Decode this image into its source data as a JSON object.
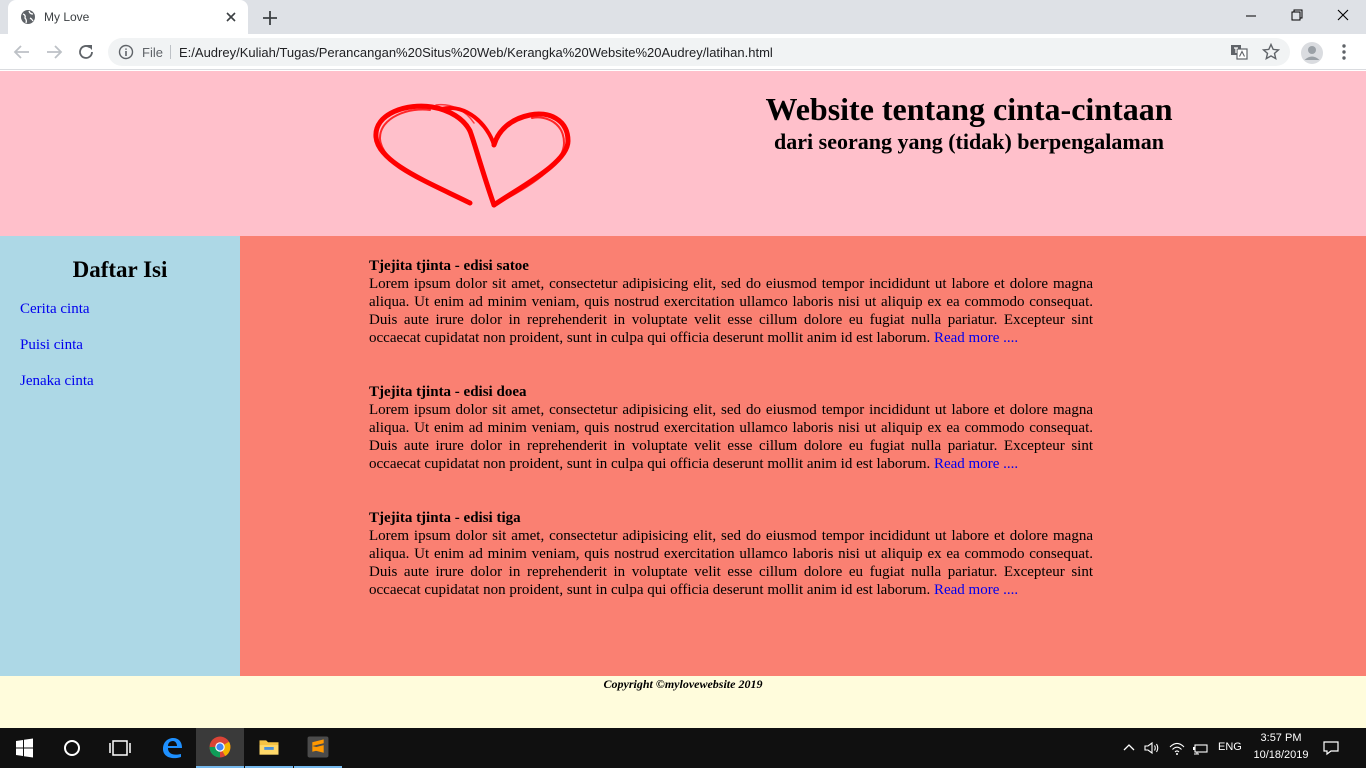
{
  "browser": {
    "tab_title": "My Love",
    "file_label": "File",
    "url": "E:/Audrey/Kuliah/Tugas/Perancangan%20Situs%20Web/Kerangka%20Website%20Audrey/latihan.html"
  },
  "site": {
    "title": "Website tentang cinta-cintaan",
    "subtitle": "dari seorang yang (tidak) berpengalaman",
    "logo_icon": "hearts-icon",
    "colors": {
      "header_bg": "#ffc0cb",
      "sidebar_bg": "#add8e6",
      "content_bg": "#fa8072",
      "footer_bg": "#fffcdc",
      "link": "#0000ee",
      "hearts": "#ff0000"
    }
  },
  "sidebar": {
    "heading": "Daftar Isi",
    "links": [
      "Cerita cinta",
      "Puisi cinta",
      "Jenaka cinta"
    ]
  },
  "articles": [
    {
      "title": "Tjejita tjinta - edisi satoe",
      "body": "Lorem ipsum dolor sit amet, consectetur adipisicing elit, sed do eiusmod tempor incididunt ut labore et dolore magna aliqua. Ut enim ad minim veniam, quis nostrud exercitation ullamco laboris nisi ut aliquip ex ea commodo consequat. Duis aute irure dolor in reprehenderit in voluptate velit esse cillum dolore eu fugiat nulla pariatur. Excepteur sint occaecat cupidatat non proident, sunt in culpa qui officia deserunt mollit anim id est laborum.",
      "read_more": "Read more ...."
    },
    {
      "title": "Tjejita tjinta - edisi doea",
      "body": "Lorem ipsum dolor sit amet, consectetur adipisicing elit, sed do eiusmod tempor incididunt ut labore et dolore magna aliqua. Ut enim ad minim veniam, quis nostrud exercitation ullamco laboris nisi ut aliquip ex ea commodo consequat. Duis aute irure dolor in reprehenderit in voluptate velit esse cillum dolore eu fugiat nulla pariatur. Excepteur sint occaecat cupidatat non proident, sunt in culpa qui officia deserunt mollit anim id est laborum.",
      "read_more": "Read more ...."
    },
    {
      "title": "Tjejita tjinta - edisi tiga",
      "body": "Lorem ipsum dolor sit amet, consectetur adipisicing elit, sed do eiusmod tempor incididunt ut labore et dolore magna aliqua. Ut enim ad minim veniam, quis nostrud exercitation ullamco laboris nisi ut aliquip ex ea commodo consequat. Duis aute irure dolor in reprehenderit in voluptate velit esse cillum dolore eu fugiat nulla pariatur. Excepteur sint occaecat cupidatat non proident, sunt in culpa qui officia deserunt mollit anim id est laborum.",
      "read_more": "Read more ...."
    }
  ],
  "footer": {
    "text": "Copyright ©mylovewebsite 2019"
  },
  "taskbar": {
    "language": "ENG",
    "time": "3:57 PM",
    "date": "10/18/2019",
    "apps": [
      "windows-start-icon",
      "cortana-search-icon",
      "task-view-icon",
      "edge-icon",
      "chrome-icon",
      "file-explorer-icon",
      "sublime-text-icon"
    ]
  }
}
